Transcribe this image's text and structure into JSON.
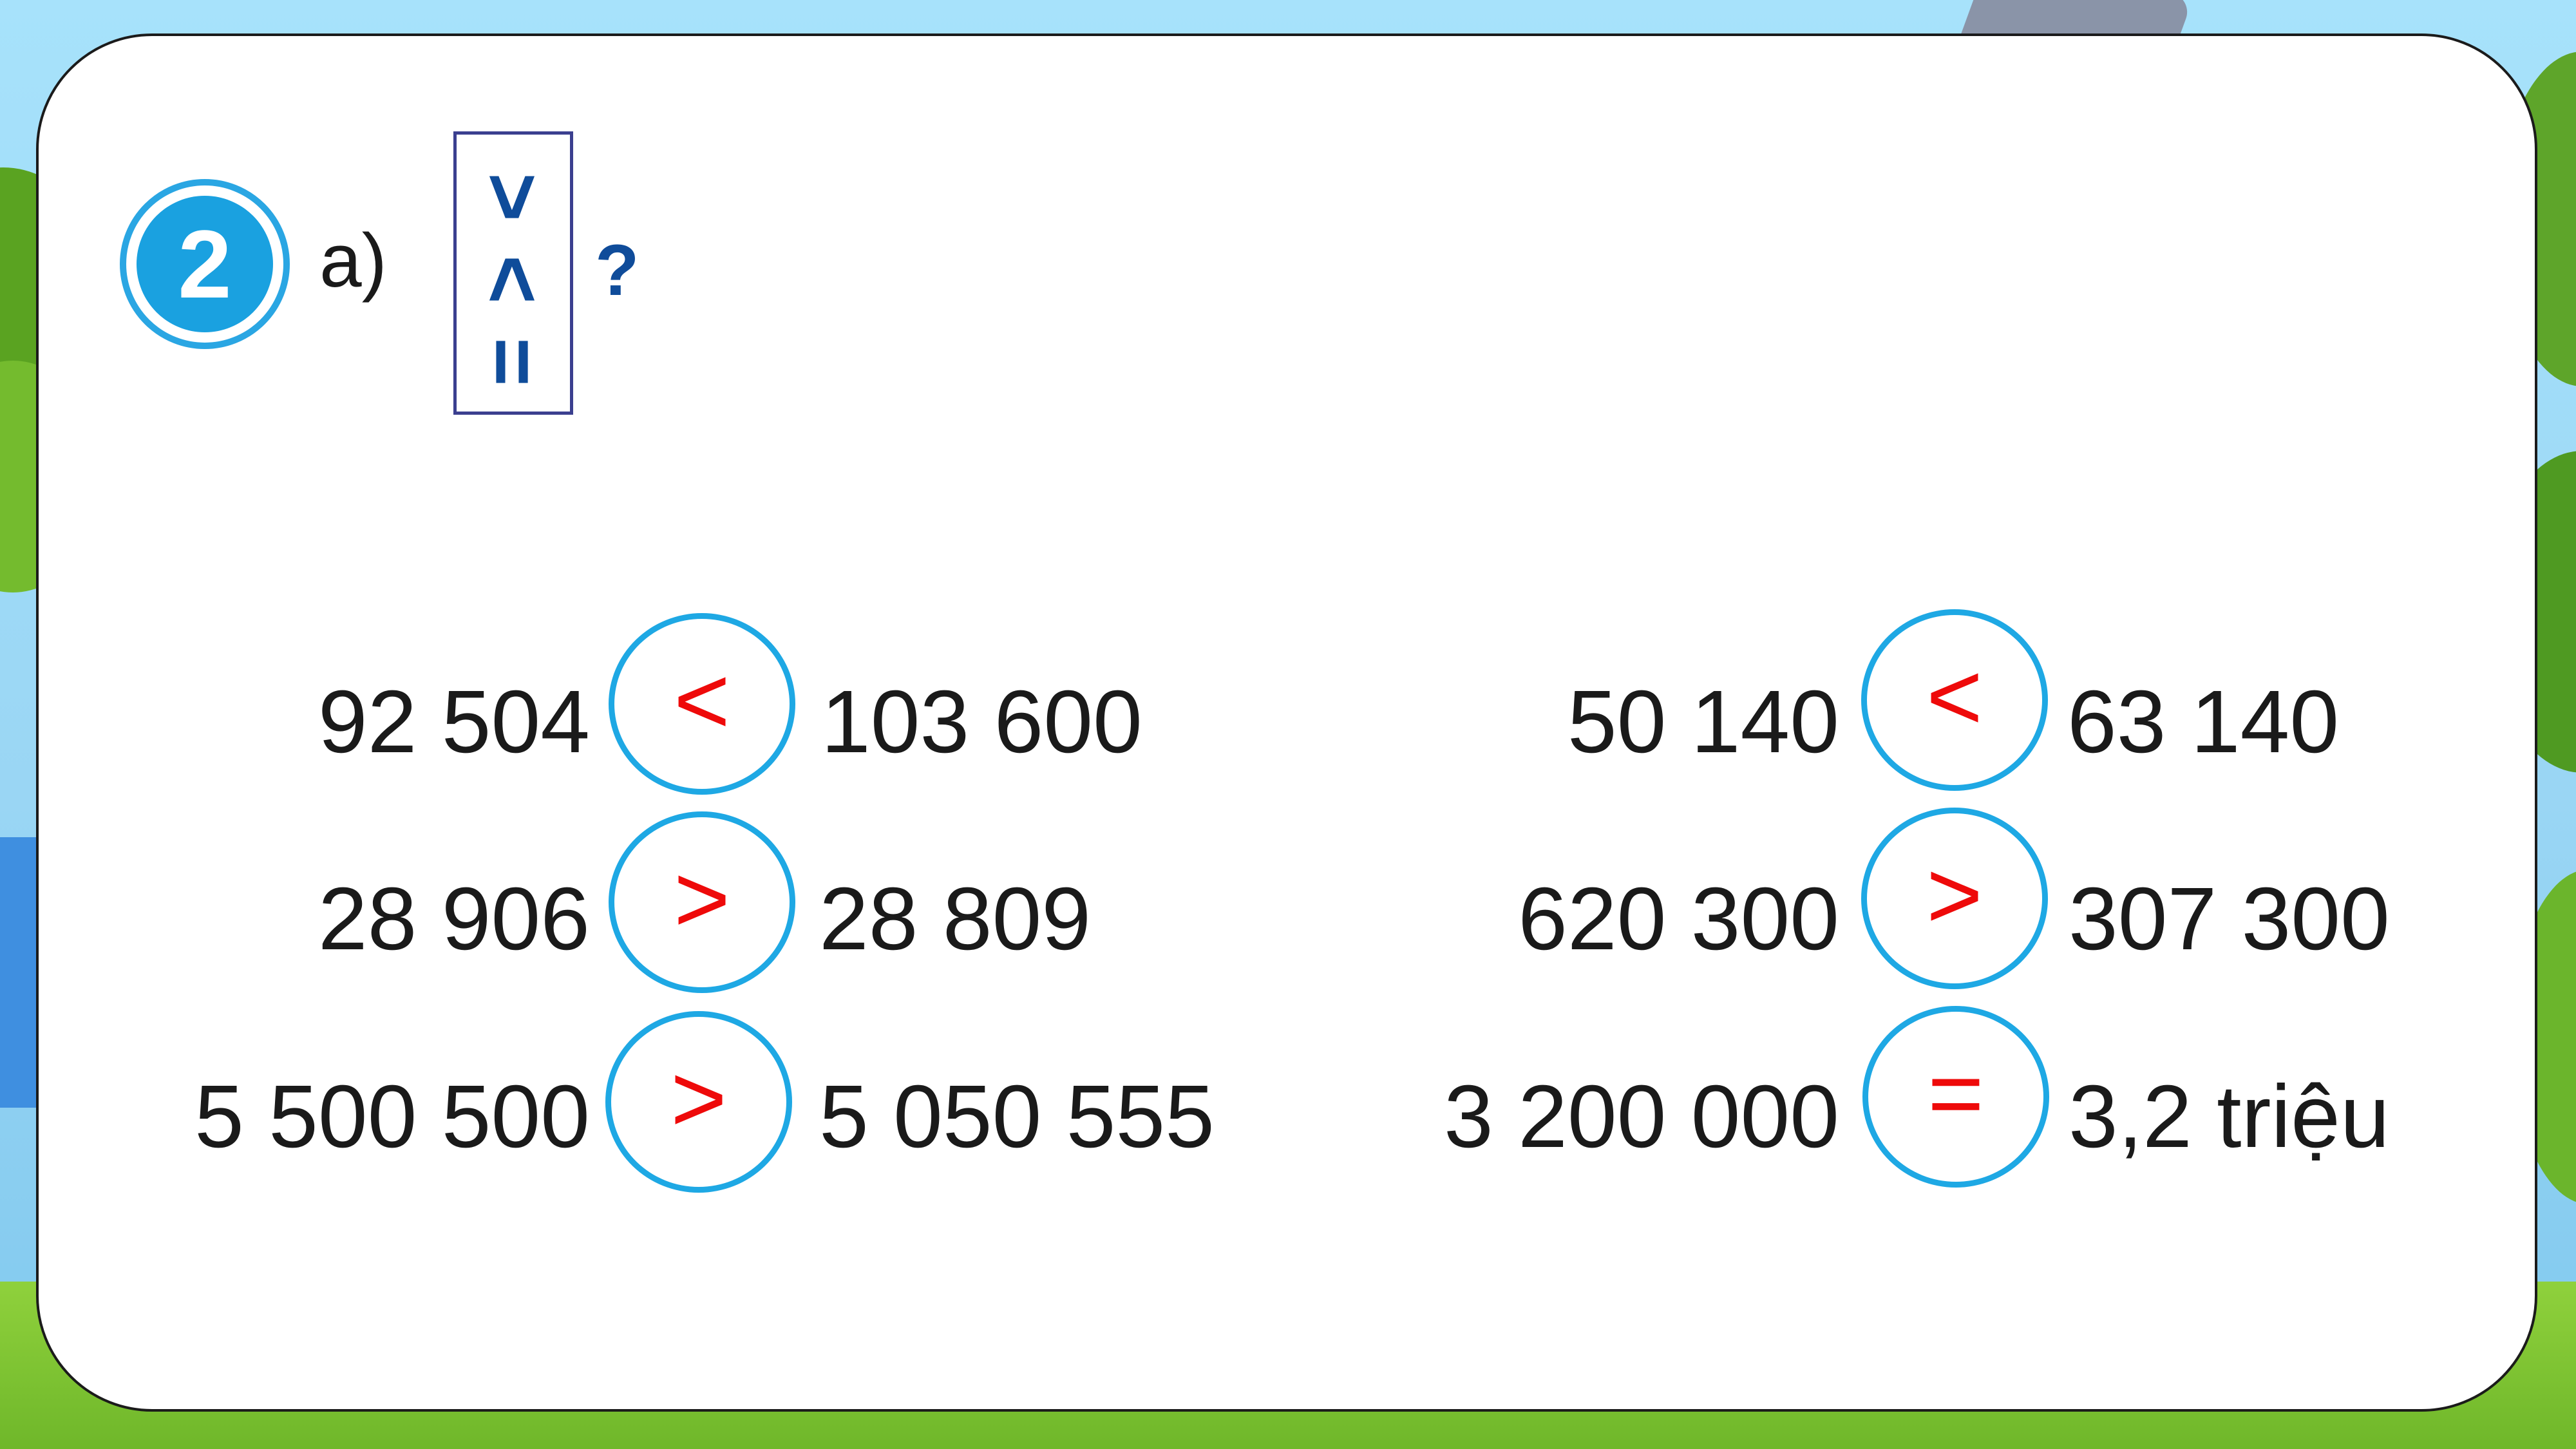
{
  "exercise": {
    "number": "2",
    "part": "a)",
    "symbols": [
      ">",
      "<",
      "="
    ],
    "prompt_mark": "?"
  },
  "comparisons": {
    "left_column": [
      {
        "left": "92 504",
        "op": "<",
        "right": "103 600"
      },
      {
        "left": "28 906",
        "op": ">",
        "right": "28 809"
      },
      {
        "left": "5 500 500",
        "op": ">",
        "right": "5 050 555"
      }
    ],
    "right_column": [
      {
        "left": "50 140",
        "op": "<",
        "right": "63 140"
      },
      {
        "left": "620 300",
        "op": ">",
        "right": "307 300"
      },
      {
        "left": "3 200 000",
        "op": "=",
        "right": "3,2 triệu"
      }
    ]
  },
  "colors": {
    "accent_blue": "#1aa1e0",
    "answer_red": "#ee0a0a",
    "symbol_blue": "#0f4c9a"
  }
}
